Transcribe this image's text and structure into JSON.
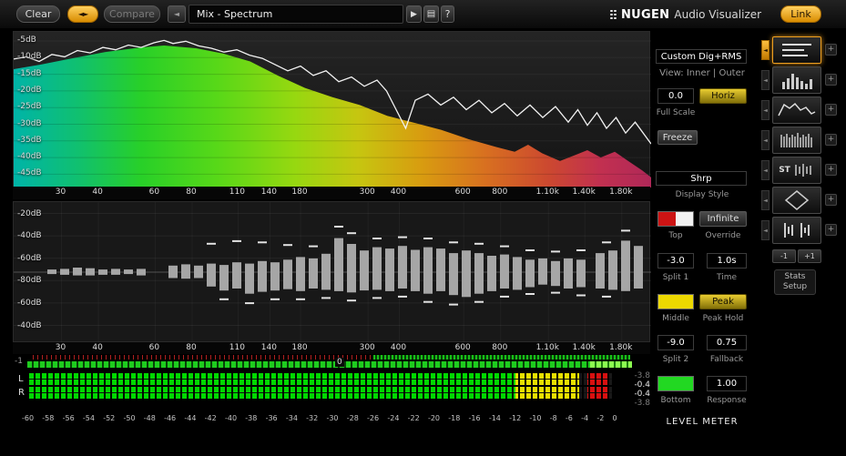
{
  "topbar": {
    "clear": "Clear",
    "compare": "Compare",
    "preset": "Mix - Spectrum",
    "logo_name": "NUGEN",
    "logo_sub": "Audio Visualizer",
    "link": "Link"
  },
  "icons": {
    "swap": "◄►",
    "prev": "◄",
    "play": "▶",
    "list": "▤",
    "help": "?",
    "plus": "+",
    "tab": "◄"
  },
  "freq_scale": {
    "labels": [
      "30",
      "40",
      "60",
      "80",
      "110",
      "140",
      "180",
      "300",
      "400",
      "600",
      "800",
      "1.10k",
      "1.40k",
      "1.80k"
    ],
    "pos": [
      0.075,
      0.133,
      0.222,
      0.28,
      0.352,
      0.402,
      0.45,
      0.556,
      0.605,
      0.706,
      0.764,
      0.839,
      0.896,
      0.954
    ]
  },
  "spectrum": {
    "db_labels": [
      "-5dB",
      "-10dB",
      "-15dB",
      "-20dB",
      "-25dB",
      "-30dB",
      "-35dB",
      "-40dB",
      "-45dB"
    ],
    "gradient": [
      [
        "0%",
        "#00b4a8"
      ],
      [
        "10%",
        "#10c070"
      ],
      [
        "20%",
        "#28d028"
      ],
      [
        "32%",
        "#58d818"
      ],
      [
        "44%",
        "#96d810"
      ],
      [
        "54%",
        "#c6c610"
      ],
      [
        "64%",
        "#d89c10"
      ],
      [
        "74%",
        "#d87020"
      ],
      [
        "84%",
        "#cc4830"
      ],
      [
        "92%",
        "#c23050"
      ],
      [
        "100%",
        "#b02858"
      ]
    ],
    "fill_points": [
      [
        0,
        0.24
      ],
      [
        0.043,
        0.21
      ],
      [
        0.086,
        0.175
      ],
      [
        0.143,
        0.13
      ],
      [
        0.2,
        0.1
      ],
      [
        0.236,
        0.088
      ],
      [
        0.286,
        0.105
      ],
      [
        0.329,
        0.14
      ],
      [
        0.371,
        0.19
      ],
      [
        0.414,
        0.28
      ],
      [
        0.457,
        0.36
      ],
      [
        0.5,
        0.42
      ],
      [
        0.543,
        0.47
      ],
      [
        0.586,
        0.54
      ],
      [
        0.629,
        0.585
      ],
      [
        0.671,
        0.63
      ],
      [
        0.714,
        0.69
      ],
      [
        0.757,
        0.74
      ],
      [
        0.786,
        0.77
      ],
      [
        0.807,
        0.725
      ],
      [
        0.829,
        0.78
      ],
      [
        0.857,
        0.83
      ],
      [
        0.879,
        0.795
      ],
      [
        0.9,
        0.76
      ],
      [
        0.921,
        0.807
      ],
      [
        0.943,
        0.77
      ],
      [
        0.964,
        0.83
      ],
      [
        0.986,
        0.89
      ],
      [
        1,
        0.935
      ]
    ],
    "line_points": [
      [
        0,
        0.175
      ],
      [
        0.02,
        0.16
      ],
      [
        0.04,
        0.19
      ],
      [
        0.06,
        0.145
      ],
      [
        0.08,
        0.16
      ],
      [
        0.1,
        0.12
      ],
      [
        0.12,
        0.135
      ],
      [
        0.14,
        0.1
      ],
      [
        0.16,
        0.115
      ],
      [
        0.18,
        0.085
      ],
      [
        0.2,
        0.1
      ],
      [
        0.22,
        0.07
      ],
      [
        0.236,
        0.055
      ],
      [
        0.25,
        0.075
      ],
      [
        0.27,
        0.06
      ],
      [
        0.29,
        0.09
      ],
      [
        0.31,
        0.105
      ],
      [
        0.33,
        0.13
      ],
      [
        0.35,
        0.115
      ],
      [
        0.37,
        0.15
      ],
      [
        0.39,
        0.17
      ],
      [
        0.41,
        0.21
      ],
      [
        0.43,
        0.25
      ],
      [
        0.45,
        0.22
      ],
      [
        0.47,
        0.28
      ],
      [
        0.49,
        0.25
      ],
      [
        0.51,
        0.32
      ],
      [
        0.53,
        0.29
      ],
      [
        0.55,
        0.35
      ],
      [
        0.57,
        0.31
      ],
      [
        0.585,
        0.38
      ],
      [
        0.6,
        0.5
      ],
      [
        0.615,
        0.62
      ],
      [
        0.63,
        0.44
      ],
      [
        0.65,
        0.4
      ],
      [
        0.67,
        0.47
      ],
      [
        0.69,
        0.42
      ],
      [
        0.71,
        0.5
      ],
      [
        0.73,
        0.44
      ],
      [
        0.75,
        0.52
      ],
      [
        0.77,
        0.46
      ],
      [
        0.79,
        0.54
      ],
      [
        0.81,
        0.47
      ],
      [
        0.83,
        0.55
      ],
      [
        0.85,
        0.48
      ],
      [
        0.87,
        0.58
      ],
      [
        0.885,
        0.5
      ],
      [
        0.9,
        0.6
      ],
      [
        0.915,
        0.52
      ],
      [
        0.93,
        0.62
      ],
      [
        0.945,
        0.55
      ],
      [
        0.96,
        0.65
      ],
      [
        0.975,
        0.58
      ],
      [
        1,
        0.72
      ]
    ]
  },
  "histogram": {
    "db_labels": [
      "-20dB",
      "-40dB",
      "-60dB",
      "-80dB",
      "-60dB",
      "-40dB"
    ],
    "bars": [
      [
        0.06,
        0.04,
        0.03
      ],
      [
        0.08,
        0.05,
        0.04
      ],
      [
        0.1,
        0.07,
        0.05
      ],
      [
        0.12,
        0.06,
        0.05
      ],
      [
        0.14,
        0.04,
        0.04
      ],
      [
        0.16,
        0.05,
        0.04
      ],
      [
        0.18,
        0.04,
        0.03
      ],
      [
        0.2,
        0.05,
        0.05
      ],
      [
        0.25,
        0.1,
        0.09
      ],
      [
        0.27,
        0.12,
        0.1
      ],
      [
        0.29,
        0.1,
        0.09
      ],
      [
        0.31,
        0.13,
        0.22
      ],
      [
        0.33,
        0.11,
        0.28
      ],
      [
        0.35,
        0.15,
        0.25
      ],
      [
        0.37,
        0.13,
        0.33
      ],
      [
        0.39,
        0.17,
        0.3
      ],
      [
        0.41,
        0.15,
        0.28
      ],
      [
        0.43,
        0.19,
        0.26
      ],
      [
        0.45,
        0.23,
        0.29
      ],
      [
        0.47,
        0.21,
        0.25
      ],
      [
        0.49,
        0.28,
        0.27
      ],
      [
        0.51,
        0.52,
        0.29
      ],
      [
        0.53,
        0.43,
        0.31
      ],
      [
        0.55,
        0.33,
        0.28
      ],
      [
        0.57,
        0.38,
        0.27
      ],
      [
        0.59,
        0.36,
        0.29
      ],
      [
        0.61,
        0.4,
        0.25
      ],
      [
        0.63,
        0.34,
        0.29
      ],
      [
        0.65,
        0.38,
        0.33
      ],
      [
        0.67,
        0.36,
        0.29
      ],
      [
        0.69,
        0.29,
        0.35
      ],
      [
        0.71,
        0.33,
        0.38
      ],
      [
        0.73,
        0.29,
        0.33
      ],
      [
        0.75,
        0.25,
        0.29
      ],
      [
        0.77,
        0.27,
        0.25
      ],
      [
        0.79,
        0.23,
        0.27
      ],
      [
        0.81,
        0.19,
        0.23
      ],
      [
        0.83,
        0.21,
        0.19
      ],
      [
        0.85,
        0.17,
        0.21
      ],
      [
        0.87,
        0.21,
        0.25
      ],
      [
        0.89,
        0.19,
        0.23
      ],
      [
        0.92,
        0.29,
        0.25
      ],
      [
        0.94,
        0.33,
        0.27
      ],
      [
        0.96,
        0.48,
        0.29
      ],
      [
        0.98,
        0.4,
        0.25
      ]
    ],
    "peaks_up": [
      [
        0.31,
        0.42
      ],
      [
        0.35,
        0.46
      ],
      [
        0.39,
        0.44
      ],
      [
        0.43,
        0.4
      ],
      [
        0.47,
        0.38
      ],
      [
        0.51,
        0.68
      ],
      [
        0.53,
        0.58
      ],
      [
        0.57,
        0.5
      ],
      [
        0.61,
        0.52
      ],
      [
        0.65,
        0.5
      ],
      [
        0.69,
        0.44
      ],
      [
        0.73,
        0.42
      ],
      [
        0.77,
        0.38
      ],
      [
        0.81,
        0.32
      ],
      [
        0.85,
        0.3
      ],
      [
        0.89,
        0.32
      ],
      [
        0.93,
        0.44
      ],
      [
        0.96,
        0.62
      ]
    ],
    "peaks_down": [
      [
        0.33,
        0.4
      ],
      [
        0.37,
        0.46
      ],
      [
        0.41,
        0.4
      ],
      [
        0.45,
        0.4
      ],
      [
        0.49,
        0.38
      ],
      [
        0.53,
        0.42
      ],
      [
        0.57,
        0.38
      ],
      [
        0.61,
        0.36
      ],
      [
        0.65,
        0.44
      ],
      [
        0.69,
        0.48
      ],
      [
        0.73,
        0.44
      ],
      [
        0.77,
        0.36
      ],
      [
        0.81,
        0.32
      ],
      [
        0.85,
        0.3
      ],
      [
        0.89,
        0.34
      ],
      [
        0.93,
        0.36
      ]
    ]
  },
  "correlation": {
    "min": "-1",
    "center": "0",
    "bright_from": 0.93
  },
  "meters": {
    "left": "L",
    "right": "R",
    "scale": [
      "-60",
      "-58",
      "-56",
      "-54",
      "-52",
      "-50",
      "-48",
      "-46",
      "-44",
      "-42",
      "-40",
      "-38",
      "-36",
      "-34",
      "-32",
      "-30",
      "-28",
      "-26",
      "-24",
      "-22",
      "-20",
      "-18",
      "-16",
      "-14",
      "-12",
      "-10",
      "-8",
      "-6",
      "-4",
      "-2",
      "0"
    ],
    "readouts": [
      {
        "value": "-3.8",
        "dim": true
      },
      {
        "value": "-0.4",
        "dim": false
      },
      {
        "value": "-0.4",
        "dim": false
      },
      {
        "value": "-3.8",
        "dim": true
      }
    ],
    "fill": {
      "green_to": 0.835,
      "yellow_to": 0.945,
      "red_from": 0.958,
      "red_to": 0.993
    },
    "colors": {
      "green": "#00d800",
      "yellow": "#e8e000",
      "red": "#d81010"
    }
  },
  "controls": {
    "mode": "Custom Dig+RMS",
    "view": "View: Inner | Outer",
    "full_scale_value": "0.0",
    "horiz": "Horiz",
    "full_scale_label": "Full Scale",
    "freeze": "Freeze",
    "style_value": "Shrp",
    "style_label": "Display Style",
    "top_label": "Top",
    "infinite": "Infinite",
    "override_label": "Override",
    "split1_value": "-3.0",
    "split1_label": "Split 1",
    "time_value": "1.0s",
    "time_label": "Time",
    "peak": "Peak",
    "middle_label": "Middle",
    "peak_hold_label": "Peak Hold",
    "split2_value": "-9.0",
    "split2_label": "Split 2",
    "fallback_value": "0.75",
    "fallback_label": "Fallback",
    "response_value": "1.00",
    "bottom_label": "Bottom",
    "response_label": "Response",
    "level_meter": "LEVEL METER",
    "colors": {
      "top_left": "#cc1414",
      "top_right": "#f2f2f2",
      "middle": "#ecd800",
      "bottom": "#22d822"
    }
  },
  "presets": {
    "st": "ST",
    "minus_one": "-1",
    "plus_one": "+1",
    "stats_line1": "Stats",
    "stats_line2": "Setup"
  }
}
